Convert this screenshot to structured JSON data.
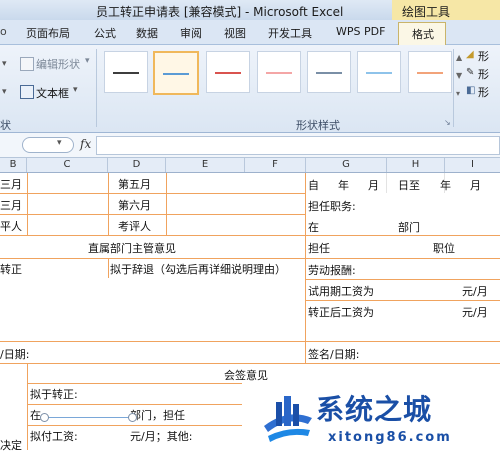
{
  "window": {
    "title": "员工转正申请表 [兼容模式] - Microsoft Excel",
    "context_tools_label": "绘图工具"
  },
  "ribbon": {
    "tabs": [
      "页面布局",
      "公式",
      "数据",
      "审阅",
      "视图",
      "开发工具",
      "WPS PDF"
    ],
    "context_tab": "格式",
    "edit_shape_label": "编辑形状",
    "text_box_label": "文本框",
    "left_group_label": "状",
    "shape_styles_label": "形状样式",
    "right_items": [
      "形",
      "形",
      "形"
    ],
    "swatch_colors": [
      "#3d3d3d",
      "#5b9bd5",
      "#d9534f",
      "#f4a6a6",
      "#7a8fa6",
      "#8ec3ea",
      "#f2a37a"
    ]
  },
  "formula_bar": {
    "fx_label": "fx",
    "value": ""
  },
  "columns": [
    "B",
    "C",
    "D",
    "E",
    "F",
    "G",
    "H",
    "I"
  ],
  "sheet": {
    "left": {
      "r1_b": "三月",
      "r1_d": "第五月",
      "r2_b": "三月",
      "r2_d": "第六月",
      "r3_b": "平人",
      "r3_d": "考评人",
      "dept_opinion": "直属部门主管意见",
      "regular": "转正",
      "dismiss": "拟于辞退（勾选后再详细说明理由）",
      "date": "/日期:"
    },
    "right": {
      "period_from": "自",
      "period_year": "年",
      "period_month": "月",
      "period_to": "日至",
      "period_year2": "年",
      "period_month2": "月",
      "position_label": "担任职务:",
      "at": "在",
      "dept": "部门",
      "serve": "担任",
      "post": "职位",
      "salary_label": "劳动报酬:",
      "probation_wage": "试用期工资为",
      "after_wage": "转正后工资为",
      "unit1": "元/月",
      "unit2": "元/月",
      "sign_date": "签名/日期:"
    },
    "countersign": "会签意见",
    "bottom": {
      "proposed_regular": "拟于转正:",
      "at2": "在",
      "dept_serve": "部门，担任",
      "proposed_wage": "拟付工资:",
      "wage_unit": "元/月；其他:",
      "decision": "决定"
    }
  },
  "watermark": {
    "title": "系统之城",
    "url": "xitong86.com"
  }
}
